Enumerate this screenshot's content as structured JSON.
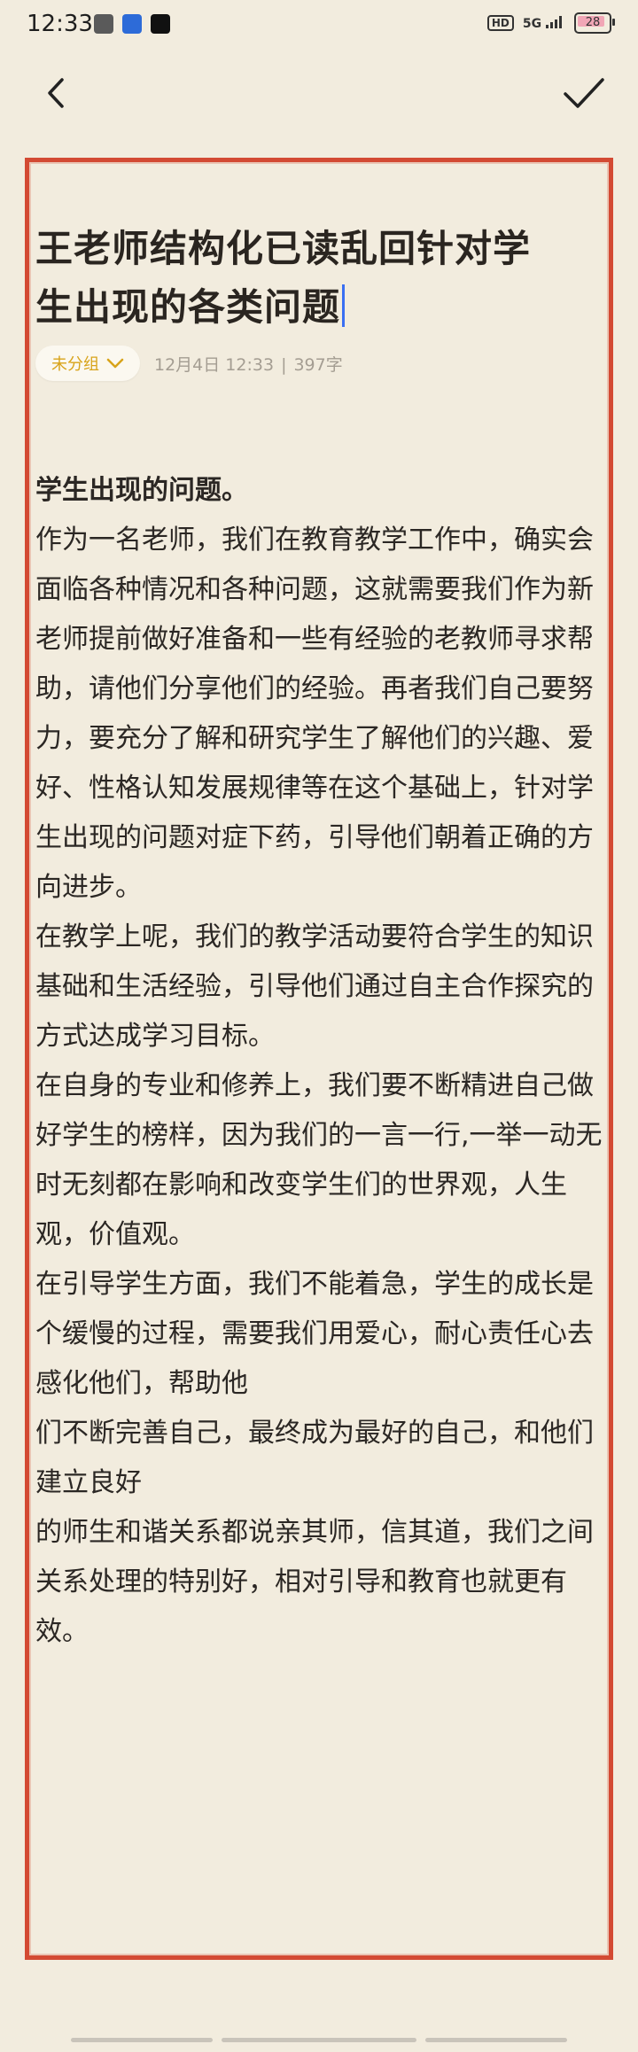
{
  "status": {
    "time": "12:33",
    "network": "5G",
    "hd": "HD",
    "battery": "28"
  },
  "icons": {
    "back": "back-arrow-icon",
    "confirm": "checkmark-icon",
    "chevron": "chevron-down-icon"
  },
  "note": {
    "title_line1": "王老师结构化已读乱回针对学",
    "title_line2": "生出现的各类问题",
    "group": "未分组",
    "date": "12月4日 12:33",
    "separator": "|",
    "word_count": "397字",
    "paragraphs": [
      "学生出现的问题。",
      "作为一名老师，我们在教育教学工作中，确实会面临各种情况和各种问题，这就需要我们作为新老师提前做好准备和一些有经验的老教师寻求帮助，请他们分享他们的经验。再者我们自己要努力，要充分了解和研究学生了解他们的兴趣、爱好、性格认知发展规律等在这个基础上，针对学生出现的问题对症下药，引导他们朝着正确的方向进步。",
      "在教学上呢，我们的教学活动要符合学生的知识基础和生活经验，引导他们通过自主合作探究的方式达成学习目标。",
      "在自身的专业和修养上，我们要不断精进自己做好学生的榜样，因为我们的一言一行,一举一动无时无刻都在影响和改变学生们的世界观，人生观，价值观。",
      "在引导学生方面，我们不能着急，学生的成长是个缓慢的过程，需要我们用爱心，耐心责任心去感化他们，帮助他",
      "们不断完善自己，最终成为最好的自己，和他们建立良好",
      "的师生和谐关系都说亲其师，信其道，我们之间关系处理的特别好，相对引导和教育也就更有效。"
    ]
  },
  "colors": {
    "background": "#f2ecde",
    "border": "#d34a33",
    "accent": "#d8a31a",
    "caret": "#3a6ff2"
  }
}
